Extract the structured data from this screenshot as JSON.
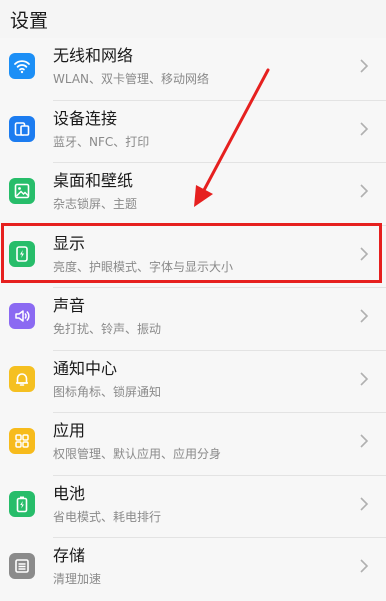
{
  "header": {
    "title": "设置"
  },
  "colors": {
    "wlan": "#1c8ff6",
    "device": "#1c7cf0",
    "desktop": "#27bd6a",
    "display": "#27bd6a",
    "sound": "#8b6af2",
    "notification": "#f5c021",
    "apps": "#f7bb1c",
    "battery": "#27bd6a",
    "storage": "#8b8b8b",
    "highlight": "#e6201f",
    "arrow": "#e6201f"
  },
  "items": [
    {
      "title": "无线和网络",
      "subtitle": "WLAN、双卡管理、移动网络",
      "icon": "wifi-icon"
    },
    {
      "title": "设备连接",
      "subtitle": "蓝牙、NFC、打印",
      "icon": "device-connection-icon"
    },
    {
      "title": "桌面和壁纸",
      "subtitle": "杂志锁屏、主题",
      "icon": "wallpaper-icon"
    },
    {
      "title": "显示",
      "subtitle": "亮度、护眼模式、字体与显示大小",
      "icon": "display-icon"
    },
    {
      "title": "声音",
      "subtitle": "免打扰、铃声、振动",
      "icon": "sound-icon"
    },
    {
      "title": "通知中心",
      "subtitle": "图标角标、锁屏通知",
      "icon": "bell-icon"
    },
    {
      "title": "应用",
      "subtitle": "权限管理、默认应用、应用分身",
      "icon": "apps-icon"
    },
    {
      "title": "电池",
      "subtitle": "省电模式、耗电排行",
      "icon": "battery-icon"
    },
    {
      "title": "存储",
      "subtitle": "清理加速",
      "icon": "storage-icon"
    }
  ]
}
